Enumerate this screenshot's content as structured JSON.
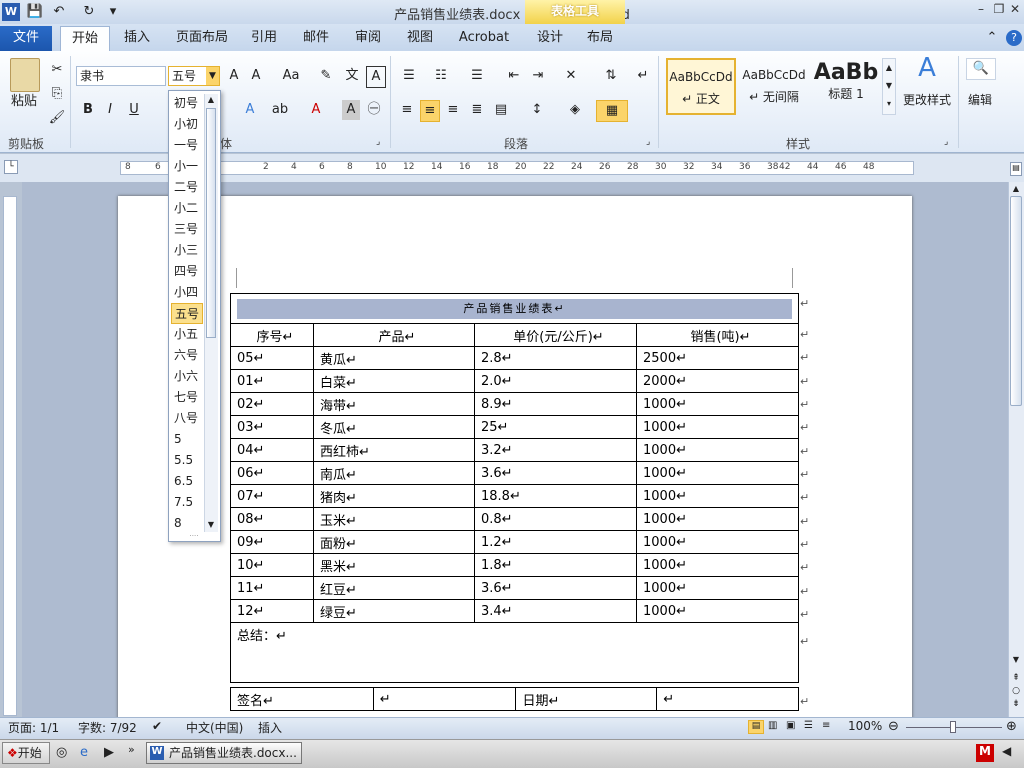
{
  "app": {
    "title": "产品销售业绩表.docx - Microsoft Word",
    "context_tab": "表格工具"
  },
  "tabs": [
    "文件",
    "开始",
    "插入",
    "页面布局",
    "引用",
    "邮件",
    "审阅",
    "视图",
    "Acrobat",
    "设计",
    "布局"
  ],
  "ribbon": {
    "paste_label": "粘贴",
    "font_name": "隶书",
    "font_size": "五号",
    "group_clipboard": "剪贴板",
    "group_font_partial": "体",
    "group_paragraph": "段落",
    "group_styles": "样式",
    "styles": [
      {
        "preview": "AaBbCcDd",
        "name": "↵ 正文"
      },
      {
        "preview": "AaBbCcDd",
        "name": "↵ 无间隔"
      },
      {
        "preview": "AaBb",
        "name": "标题 1"
      }
    ],
    "change_styles": "更改样式",
    "edit": "编辑"
  },
  "font_size_dropdown": [
    "初号",
    "小初",
    "一号",
    "小一",
    "二号",
    "小二",
    "三号",
    "小三",
    "四号",
    "小四",
    "五号",
    "小五",
    "六号",
    "小六",
    "七号",
    "八号",
    "5",
    "5.5",
    "6.5",
    "7.5",
    "8"
  ],
  "selected_size": "五号",
  "ruler": {
    "h_ticks": [
      "8",
      "6",
      "4",
      "2",
      "2",
      "4",
      "6",
      "8",
      "10",
      "12",
      "14",
      "16",
      "18",
      "20",
      "22",
      "24",
      "26",
      "28",
      "30",
      "32",
      "34",
      "36",
      "38",
      "42",
      "44",
      "46",
      "48"
    ]
  },
  "document": {
    "table_title": "产品销售业绩表↵",
    "headers": [
      "序号↵",
      "产品↵",
      "单价(元/公斤)↵",
      "销售(吨)↵"
    ],
    "rows": [
      [
        "05↵",
        "黄瓜↵",
        "2.8↵",
        "2500↵"
      ],
      [
        "01↵",
        "白菜↵",
        "2.0↵",
        "2000↵"
      ],
      [
        "02↵",
        "海带↵",
        "8.9↵",
        "1000↵"
      ],
      [
        "03↵",
        "冬瓜↵",
        "25↵",
        "1000↵"
      ],
      [
        "04↵",
        "西红柿↵",
        "3.2↵",
        "1000↵"
      ],
      [
        "06↵",
        "南瓜↵",
        "3.6↵",
        "1000↵"
      ],
      [
        "07↵",
        "猪肉↵",
        "18.8↵",
        "1000↵"
      ],
      [
        "08↵",
        "玉米↵",
        "0.8↵",
        "1000↵"
      ],
      [
        "09↵",
        "面粉↵",
        "1.2↵",
        "1000↵"
      ],
      [
        "10↵",
        "黑米↵",
        "1.8↵",
        "1000↵"
      ],
      [
        "11↵",
        "红豆↵",
        "3.6↵",
        "1000↵"
      ],
      [
        "12↵",
        "绿豆↵",
        "3.4↵",
        "1000↵"
      ]
    ],
    "summary": "总结：↵",
    "sign": "签名↵",
    "date": "日期↵",
    "blank": "↵",
    "row_end": "↵"
  },
  "status": {
    "page": "页面: 1/1",
    "words": "字数: 7/92",
    "lang": "中文(中国)",
    "mode": "插入",
    "zoom": "100%"
  },
  "taskbar": {
    "start": "开始",
    "window": "产品销售业绩表.docx..."
  }
}
